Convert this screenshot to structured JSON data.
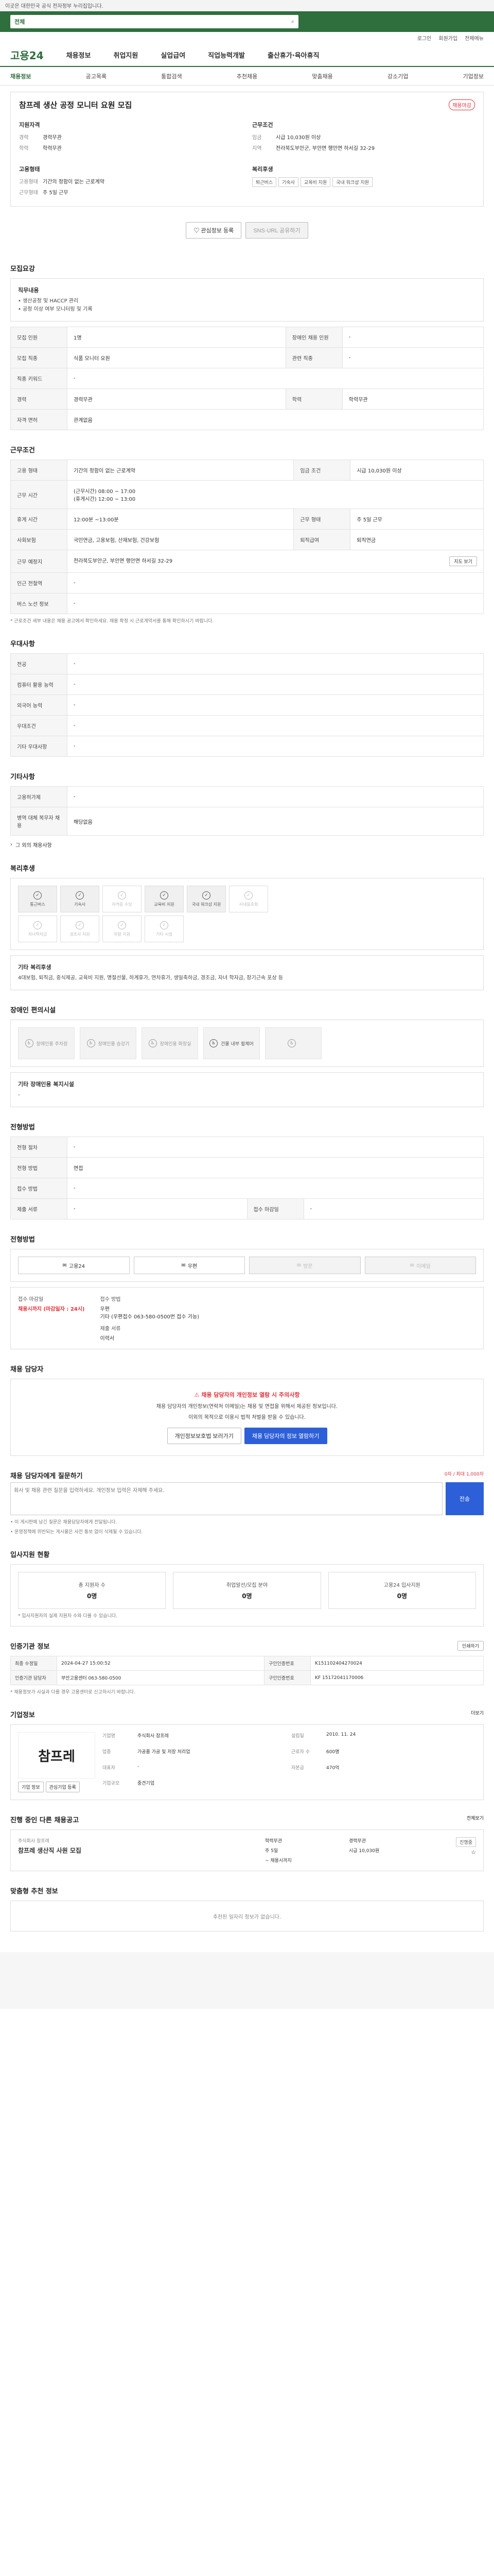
{
  "topbar": {
    "notice": "이곳은 대한민국 공식 전자정부 누리집입니다."
  },
  "search": {
    "scope": "전체",
    "placeholder": "검색어를 입력하세요"
  },
  "utility": {
    "login": "로그인",
    "signup": "회원가입",
    "sitemap": "전체메뉴"
  },
  "gnb": {
    "logo": "고용24",
    "items": [
      "채용정보",
      "취업지원",
      "실업급여",
      "직업능력개발",
      "출산휴가·육아휴직"
    ]
  },
  "subnav": {
    "items": [
      "채용정보",
      "공고목록",
      "통합검색",
      "추천채용",
      "맞춤채용",
      "강소기업",
      "기업정보"
    ]
  },
  "job": {
    "title": "참프레 생산 공정 모니터 요원 모집",
    "badge": "채용마감",
    "qual_head": "지원자격",
    "qual": [
      {
        "k": "경력",
        "v": "경력무관"
      },
      {
        "k": "학력",
        "v": "학력무관"
      }
    ],
    "cond_head": "근무조건",
    "cond": [
      {
        "k": "임금",
        "v": "시급 10,030원 이상"
      },
      {
        "k": "지역",
        "v": "전라북도부안군, 부안면 행안면 하서길 32-29"
      }
    ],
    "emp_head": "고용형태",
    "emp": [
      {
        "k": "고용형태",
        "v": "기간의 정함이 없는 근로계약"
      },
      {
        "k": "근무형태",
        "v": "주 5일 근무"
      }
    ],
    "welfare_head": "복리후생",
    "tags": [
      "퇴근버스",
      "기숙사",
      "교육비 지원",
      "국내 워크샵 지원"
    ],
    "scrap": "관심정보 등록",
    "share": "SNS·URL 공유하기"
  },
  "summary": {
    "title": "모집요강",
    "box_head": "직무내용",
    "box_lines": [
      "• 생산공정 및 HACCP 관리",
      "• 공정 이상 여부 모니터링 및 기록"
    ],
    "rows": [
      [
        "모집 인원",
        "1명",
        "장애인 채용 인원",
        "-"
      ],
      [
        "모집 직종",
        "식품 모니터 요원",
        "관련 직종",
        "-"
      ],
      [
        "직종 키워드",
        "-",
        "",
        ""
      ],
      [
        "경력",
        "경력무관",
        "학력",
        "학력무관"
      ],
      [
        "자격 면허",
        "관계없음",
        "",
        ""
      ]
    ]
  },
  "conditions": {
    "title": "근무조건",
    "rows": [
      [
        "고용 형태",
        "기간의 정함이 없는 근로계약",
        "임금 조건",
        "시급 10,030원 이상"
      ],
      [
        "근무 시간",
        "(근무시간) 08:00 ~ 17:00\n(휴게시간) 12:00 ~ 13:00",
        "",
        ""
      ],
      [
        "휴게 시간",
        "12:00분 ~13:00분",
        "근무 형태",
        "주 5일 근무"
      ],
      [
        "사회보험",
        "국민연금, 고용보험, 산재보험, 건강보험",
        "퇴직급여",
        "퇴직연금"
      ],
      [
        "근무 예정지",
        "전라북도부안군, 부안면 행안면 하서길 32-29",
        "",
        ""
      ],
      [
        "인근 전철역",
        "-",
        "",
        ""
      ],
      [
        "버스 노선 정보",
        "-",
        "",
        ""
      ]
    ],
    "note": "* 근로조건 세부 내용은 채용 공고에서 확인하세요. 채용 확정 시 근로계약서를 통해 확인하시기 바랍니다.",
    "map_btn": "지도 보기"
  },
  "preferred": {
    "title": "우대사항",
    "rows": [
      [
        "전공",
        "-"
      ],
      [
        "컴퓨터 활용 능력",
        "-"
      ],
      [
        "외국어 능력",
        "-"
      ],
      [
        "우대조건",
        "-"
      ],
      [
        "기타 우대사항",
        "-"
      ]
    ]
  },
  "etc": {
    "title": "기타사항",
    "rows": [
      [
        "고용허가제",
        "-"
      ],
      [
        "병역 대체 복무자 채용",
        "해당없음"
      ]
    ],
    "link": "그 외의 채용사항"
  },
  "welfare": {
    "title": "복리후생",
    "tiles": [
      {
        "label": "통근버스",
        "on": true
      },
      {
        "label": "기숙사",
        "on": true
      },
      {
        "label": "자격증 수당",
        "on": false
      },
      {
        "label": "교육비 지원",
        "on": true
      },
      {
        "label": "국내 워크샵 지원",
        "on": true
      },
      {
        "label": "사내동호회",
        "on": false
      },
      {
        "label": "자녀학자금",
        "on": false
      },
      {
        "label": "경조사 지원",
        "on": false
      },
      {
        "label": "차량 지원",
        "on": false
      },
      {
        "label": "기타 시설",
        "on": false
      }
    ],
    "box_head": "기타 복리후생",
    "box_text": "4대보험, 퇴직금, 중식제공, 교육비 지원, 명절선물, 하계휴가, 연차휴가, 생일축하금, 경조금, 자녀 학자금, 장기근속 포상 등"
  },
  "disability": {
    "title": "장애인 편의시설",
    "tiles": [
      {
        "label": "장애인용 주차장",
        "on": false
      },
      {
        "label": "장애인용 승강기",
        "on": false
      },
      {
        "label": "장애인용 화장실",
        "on": false
      },
      {
        "label": "건물 내부 휠체어",
        "on": true
      },
      {
        "label": "",
        "on": false
      }
    ],
    "box_head": "기타 장애인용 복지시설",
    "box_text": "-"
  },
  "process": {
    "title": "전형방법",
    "rows": [
      [
        "전형 절차",
        "-",
        "",
        ""
      ],
      [
        "전형 방법",
        "면접",
        "",
        ""
      ],
      [
        "접수 방법",
        "-",
        "",
        ""
      ],
      [
        "제출 서류",
        "-",
        "접수 마감일",
        "-"
      ]
    ],
    "labels": {
      "deadline": "채용 마감일",
      "period": "제출 서류 준비"
    }
  },
  "apply": {
    "title": "전형방법",
    "methods": [
      {
        "label": "고용24",
        "dim": false
      },
      {
        "label": "우편",
        "dim": false
      },
      {
        "label": "방문",
        "dim": true
      },
      {
        "label": "이메일",
        "dim": true
      }
    ],
    "deadline_label": "접수 마감일",
    "deadline_value": "채용시까지 (마감일자 : 24시)",
    "contact_label": "접수 방법",
    "contact_lines": [
      "우편",
      "기타 (우편접수 063-580-0500번 접수 가능)"
    ],
    "papers_label": "제출 서류",
    "papers_value": "이력서"
  },
  "warning": {
    "title": "채용 담당자",
    "line1": "채용 담당자의 개인정보 열람 시 주의사항",
    "line2": "채용 담당자의 개인정보(연락처 이메일)는 채용 및 면접을 위해서 제공된 정보입니다.",
    "line3": "이외의 목적으로 이용시 법적 처벌을 받을 수 있습니다.",
    "btn_privacy": "개인정보보호법 보러가기",
    "btn_show": "채용 담당자의 정보 열람하기"
  },
  "inquiry": {
    "title": "채용 담당자에게 질문하기",
    "counter": "0자 / 최대 1,000자",
    "placeholder": "회사 및 채용 관련 질문을 입력하세요. 개인정보 입력은 자제해 주세요.",
    "send": "전송",
    "notes": [
      "• 이 게시판에 남긴 질문은 채용담당자에게 전달됩니다.",
      "• 운영정책에 위반되는 게시물은 사전 통보 없이 삭제될 수 있습니다."
    ]
  },
  "applicants": {
    "title": "입사지원 현황",
    "stats": [
      {
        "l": "총 지원자 수",
        "n": "0명"
      },
      {
        "l": "취업알선/모집 분야",
        "n": "0명"
      },
      {
        "l": "고용24 입사지원",
        "n": "0명"
      }
    ],
    "note": "* 입사지원자의 실제 지원자 수와 다를 수 있습니다."
  },
  "auth": {
    "title": "인증기관 정보",
    "print": "인쇄하기",
    "rows": [
      [
        "최종 수정일",
        "2024-04-27 15:00:52",
        "구인인증번호",
        "K151102404270024"
      ],
      [
        "인증기관 담당자",
        "부안고용센터 063-580-0500",
        "구인인증번호",
        "KF 15172041170006"
      ]
    ],
    "note": "* 채용정보가 사실과 다를 경우 고용센터로 신고하시기 바랍니다."
  },
  "company": {
    "title": "기업정보",
    "more": "더보기",
    "logo_text": "참프레",
    "rows": [
      [
        "기업명",
        "주식회사 참프레",
        "설립일",
        "2010. 11. 24"
      ],
      [
        "업종",
        "가공품 가공 및 저장 처리업",
        "근로자 수",
        "600명"
      ],
      [
        "대표자",
        "-",
        "자본금",
        "470억"
      ],
      [
        "기업규모",
        "중견기업",
        "",
        ""
      ]
    ],
    "btn_info": "기업 정보",
    "btn_favorite": "관심기업 등록"
  },
  "others": {
    "title": "진행 중인 다른 채용공고",
    "more": "전체보기",
    "company": "주식회사 참프레",
    "job": "참프레 생산직 사원 모집",
    "meta": [
      "학력무관",
      "경력무관",
      "주 5일",
      "시급 10,030원",
      "~ 채용시까지"
    ],
    "status": "진행중"
  },
  "recommend": {
    "title": "맞춤형 추천 정보",
    "empty": "추천된 일자리 정보가 없습니다."
  },
  "colors": {
    "brand": "#2f6e3d",
    "accent": "#2d5fd8",
    "alert": "#e0333a"
  }
}
